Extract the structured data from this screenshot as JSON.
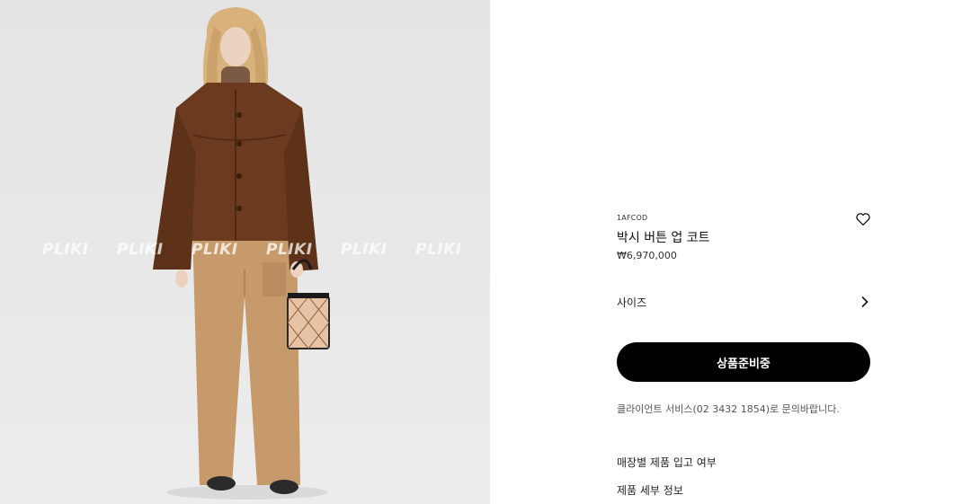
{
  "product_image": {
    "alt": "product-photo",
    "watermark_text": "PLIKI"
  },
  "product": {
    "sku": "1AFCOD",
    "name": "박시 버튼 업 코트",
    "price": "₩6,970,000",
    "wishlist_icon": "heart-outline-icon"
  },
  "size_selector": {
    "label": "사이즈",
    "icon": "chevron-right-icon"
  },
  "cta": {
    "label": "상품준비중"
  },
  "service": {
    "text": "클라이언트 서비스(02 3432 1854)로 문의바랍니다."
  },
  "links": {
    "store_stock": "매장별 제품 입고 여부",
    "product_details": "제품 세부 정보"
  },
  "colors": {
    "cta_background": "#000000",
    "cta_text": "#ffffff",
    "coat": "#6b3a1f",
    "trousers": "#c69a6b"
  }
}
